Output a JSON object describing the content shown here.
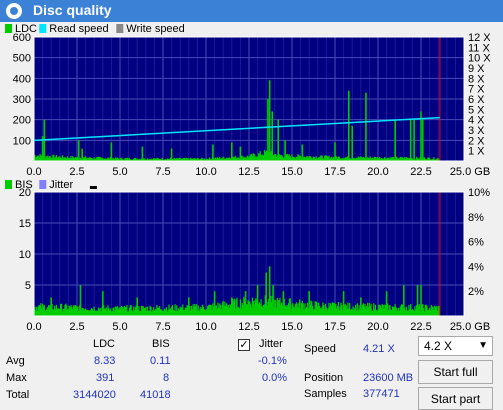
{
  "window": {
    "title": "Disc quality"
  },
  "colors": {
    "ldc": "#00cc00",
    "bis": "#00cc00",
    "read_speed": "#00e5ff",
    "jitter": "#7f7fff",
    "write_speed": "#888888",
    "plot_bg": "#000080",
    "marker": "#ff0000"
  },
  "chart_data": [
    {
      "type": "bar",
      "title": "",
      "legend": [
        "LDC",
        "Read speed",
        "Write speed"
      ],
      "x_ticks": [
        "0.0",
        "2.5",
        "5.0",
        "7.5",
        "10.0",
        "12.5",
        "15.0",
        "17.5",
        "20.0",
        "22.5",
        "25.0 GB"
      ],
      "xlim": [
        0,
        25
      ],
      "ylim": [
        0,
        600
      ],
      "y_ticks_left": [
        "600",
        "500",
        "400",
        "300",
        "200",
        "100"
      ],
      "y_ticks_right": [
        "12 X",
        "11 X",
        "10 X",
        "9 X",
        "8 X",
        "7 X",
        "6 X",
        "5 X",
        "4 X",
        "3 X",
        "2 X",
        "1 X"
      ],
      "x_grid_major": [
        0,
        2.5,
        5,
        7.5,
        10,
        12.5,
        15,
        17.5,
        20,
        22.5,
        25
      ],
      "y_grid": [
        100,
        200,
        300,
        400,
        500,
        600
      ],
      "end_marker_x": 23.6,
      "ldc_baseline_profile": [
        [
          0,
          28
        ],
        [
          1,
          22
        ],
        [
          2,
          18
        ],
        [
          3,
          16
        ],
        [
          5,
          12
        ],
        [
          7.5,
          11
        ],
        [
          10,
          11
        ],
        [
          12.5,
          22
        ],
        [
          13.5,
          40
        ],
        [
          14.5,
          25
        ],
        [
          17.5,
          18
        ],
        [
          20,
          16
        ],
        [
          22.5,
          14
        ],
        [
          23.6,
          12
        ]
      ],
      "ldc_spikes": [
        [
          0.5,
          120
        ],
        [
          0.6,
          200
        ],
        [
          2.6,
          100
        ],
        [
          2.8,
          60
        ],
        [
          4.5,
          90
        ],
        [
          6.3,
          70
        ],
        [
          8.0,
          60
        ],
        [
          10.4,
          80
        ],
        [
          11.5,
          90
        ],
        [
          12.0,
          70
        ],
        [
          13.6,
          300
        ],
        [
          13.7,
          391
        ],
        [
          13.85,
          240
        ],
        [
          14.2,
          200
        ],
        [
          14.6,
          100
        ],
        [
          15.6,
          80
        ],
        [
          17.5,
          90
        ],
        [
          18.3,
          340
        ],
        [
          18.5,
          170
        ],
        [
          19.3,
          330
        ],
        [
          21.0,
          200
        ],
        [
          21.9,
          200
        ],
        [
          22.1,
          200
        ],
        [
          22.5,
          240
        ],
        [
          22.6,
          200
        ]
      ],
      "read_speed_points": [
        [
          0,
          2.0
        ],
        [
          23.6,
          4.2
        ]
      ],
      "read_speed_unit": "X",
      "read_speed_max": 12
    },
    {
      "type": "bar",
      "title": "",
      "legend": [
        "BIS",
        "Jitter"
      ],
      "x_ticks": [
        "0.0",
        "2.5",
        "5.0",
        "7.5",
        "10.0",
        "12.5",
        "15.0",
        "17.5",
        "20.0",
        "22.5",
        "25.0 GB"
      ],
      "xlim": [
        0,
        25
      ],
      "ylim": [
        0,
        20
      ],
      "y_ticks_left": [
        "20",
        "15",
        "10",
        "5"
      ],
      "y_ticks_right": [
        "10%",
        "8%",
        "6%",
        "4%",
        "2%"
      ],
      "end_marker_x": 23.6,
      "bis_baseline_profile": [
        [
          0,
          1.5
        ],
        [
          5,
          1.2
        ],
        [
          10,
          1.4
        ],
        [
          13,
          2.5
        ],
        [
          14,
          2.2
        ],
        [
          17,
          1.6
        ],
        [
          23.6,
          1.3
        ]
      ],
      "bis_spikes": [
        [
          1.0,
          3
        ],
        [
          2.7,
          5
        ],
        [
          4.0,
          4
        ],
        [
          6.0,
          3
        ],
        [
          9.0,
          3
        ],
        [
          10.5,
          4
        ],
        [
          11.5,
          3
        ],
        [
          12.3,
          4
        ],
        [
          13.0,
          5
        ],
        [
          13.5,
          7
        ],
        [
          13.7,
          8
        ],
        [
          13.9,
          5
        ],
        [
          14.5,
          4
        ],
        [
          16.0,
          4
        ],
        [
          18.0,
          4
        ],
        [
          19.0,
          3
        ],
        [
          20.5,
          4
        ],
        [
          21.5,
          5
        ],
        [
          22.3,
          5
        ],
        [
          22.5,
          5
        ]
      ]
    }
  ],
  "stats": {
    "col_ldc": "LDC",
    "col_bis": "BIS",
    "row_avg": "Avg",
    "row_max": "Max",
    "row_total": "Total",
    "ldc_avg": "8.33",
    "ldc_max": "391",
    "ldc_total": "3144020",
    "bis_avg": "0.11",
    "bis_max": "8",
    "bis_total": "41018",
    "jitter_label": "Jitter",
    "jitter_checked": "✓",
    "jitter_avg": "-0.1%",
    "jitter_max": "0.0%"
  },
  "info": {
    "speed_label": "Speed",
    "speed_value": "4.21 X",
    "position_label": "Position",
    "position_value": "23600 MB",
    "samples_label": "Samples",
    "samples_value": "377471"
  },
  "controls": {
    "speed_select_value": "4.2 X",
    "start_full_label": "Start full",
    "start_part_label": "Start part"
  }
}
